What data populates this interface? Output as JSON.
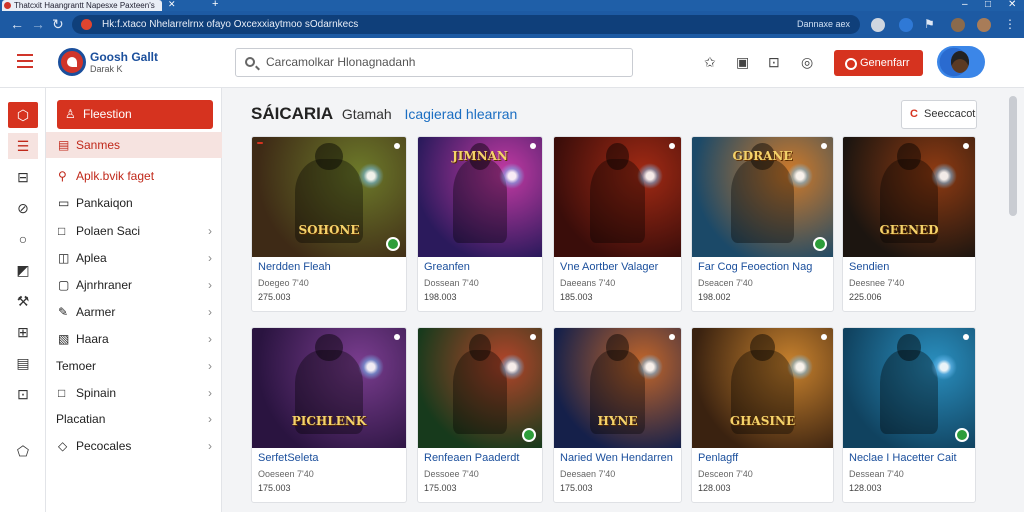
{
  "browser": {
    "tab_title": "Thatcxit Haangrantt Napesxe Paxteen's",
    "address": "Hk:f.xtaco Nhelarrelrnx ofayo Oxcexxiaytmoo sOdarnkecs",
    "address_right": "Dannaxe aex"
  },
  "header": {
    "brand_title": "Goosh Gallt",
    "brand_sub": "Darak K",
    "search_placeholder": "Carcamolkar Hlonagnadanh",
    "cta_label": "Genenfarr"
  },
  "rail": [
    {
      "icon": "hexagon-icon"
    },
    {
      "icon": "list-icon"
    },
    {
      "icon": "bag-icon"
    },
    {
      "icon": "compass-icon"
    },
    {
      "icon": "circle-icon"
    },
    {
      "icon": "flag-icon"
    },
    {
      "icon": "tools-icon"
    },
    {
      "icon": "grid-icon"
    },
    {
      "icon": "tile-icon"
    },
    {
      "icon": "apps-icon"
    },
    {
      "icon": "shield-icon"
    }
  ],
  "sidebar": {
    "items": [
      {
        "label": "Fleestion"
      },
      {
        "label": "Sanmes"
      },
      {
        "label": "Aplk.bvik faget"
      },
      {
        "label": "Pankaiqon"
      },
      {
        "label": "Polaen Saci"
      },
      {
        "label": "Aplea"
      },
      {
        "label": "Ajnrhraner"
      },
      {
        "label": "Aarmer"
      },
      {
        "label": "Haara"
      },
      {
        "label": "Temoer"
      },
      {
        "label": "Spinain"
      },
      {
        "label": "Placatian"
      },
      {
        "label": "Pecocales"
      }
    ]
  },
  "main": {
    "heading_bold": "SÁICARIA",
    "heading_mid": "Gtamah",
    "heading_link": "Icagierad hlearran",
    "filter_label": "Seeccacot",
    "cards": [
      {
        "title": "Nerdden Fleah",
        "meta": "Doegeo 7'40",
        "price": "275.003",
        "thumb_text": "SOHONE",
        "bg1": "#3e2a16",
        "bg2": "#6d7a2a"
      },
      {
        "title": "Greanfen",
        "meta": "Dossean 7'40",
        "price": "198.003",
        "thumb_text": "JIMNAN",
        "bg1": "#2b1a5c",
        "bg2": "#c33aa3"
      },
      {
        "title": "Vne Aortber Valager",
        "meta": "Daeeans 7'40",
        "price": "185.003",
        "thumb_text": "",
        "bg1": "#3a0d0a",
        "bg2": "#a22a14"
      },
      {
        "title": "Far Cog Feoection Nag",
        "meta": "Dseacen 7'40",
        "price": "198.002",
        "thumb_text": "GDRANE",
        "bg1": "#1b4968",
        "bg2": "#cf7a2a"
      },
      {
        "title": "Sendien",
        "meta": "Deesnee 7'40",
        "price": "225.006",
        "thumb_text": "GEENED",
        "bg1": "#1c1510",
        "bg2": "#8f3b12"
      },
      {
        "title": "SerfetSeleta",
        "meta": "Ooeseen 7'40",
        "price": "175.003",
        "thumb_text": "PICHLENK",
        "bg1": "#2a1440",
        "bg2": "#7a3d8f"
      },
      {
        "title": "Renfeaen Paaderdt",
        "meta": "Dessoee 7'40",
        "price": "175.003",
        "thumb_text": "",
        "bg1": "#173a1c",
        "bg2": "#b3452a"
      },
      {
        "title": "Naried Wen Hendarren",
        "meta": "Deesaen 7'40",
        "price": "175.003",
        "thumb_text": "HYNE",
        "bg1": "#15204a",
        "bg2": "#c2662a"
      },
      {
        "title": "Penlagff",
        "meta": "Desceon 7'40",
        "price": "128.003",
        "thumb_text": "GHASINE",
        "bg1": "#3a2210",
        "bg2": "#c8822e"
      },
      {
        "title": "Neclae I Hacetter Cait",
        "meta": "Dessean 7'40",
        "price": "128.003",
        "thumb_text": "",
        "bg1": "#10425f",
        "bg2": "#2a8fbf"
      }
    ]
  }
}
